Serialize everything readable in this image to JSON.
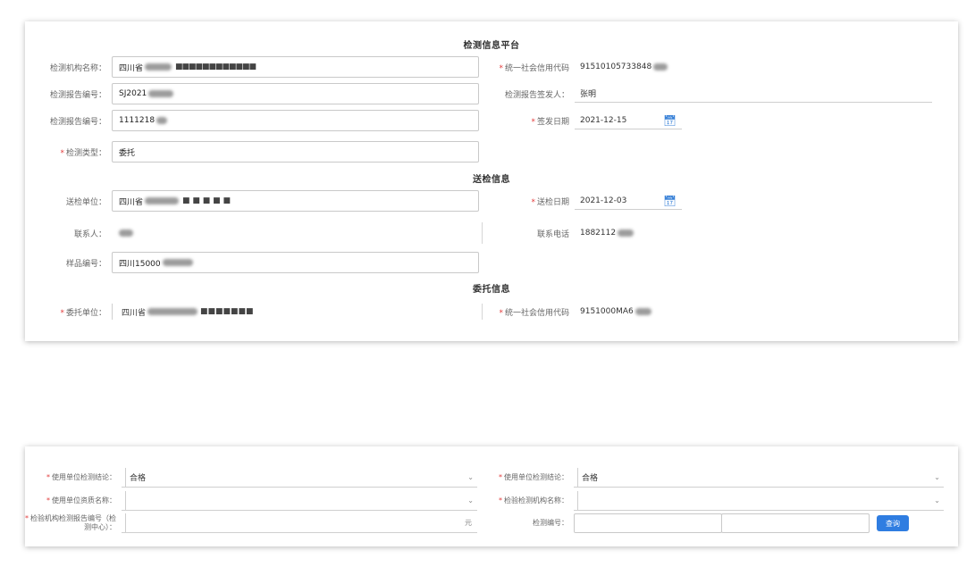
{
  "card1": {
    "sections": [
      "检测信息平台",
      "送检信息",
      "委托信息"
    ],
    "rows": [
      {
        "label": "检测机构名称",
        "value": "四川省",
        "required": false
      },
      {
        "label": "统一社会信用代码",
        "value": "91510105733848",
        "required": true
      },
      {
        "label": "检测报告编号",
        "value": "SJ2021",
        "required": false
      },
      {
        "label": "检测报告签发人",
        "value": "张明",
        "required": false
      },
      {
        "label": "检测报告编号",
        "value": "1111218",
        "required": false
      },
      {
        "label": "签发日期",
        "value": "2021-12-15",
        "required": true
      },
      {
        "label": "检测类型",
        "value": "委托",
        "required": true
      },
      {
        "label": "送检单位",
        "value": "四川省",
        "required": false
      },
      {
        "label": "送检日期",
        "value": "2021-12-03",
        "required": true
      },
      {
        "label": "联系人",
        "value": "",
        "required": false
      },
      {
        "label": "联系电话",
        "value": "1882112",
        "required": false
      },
      {
        "label": "样品编号",
        "value": "四川15000",
        "required": false
      },
      {
        "label": "委托单位",
        "value": "四川省",
        "required": true
      },
      {
        "label": "统一社会信用代码",
        "value": "9151000MA6",
        "required": true
      }
    ]
  },
  "card2": {
    "rows": [
      {
        "label": "使用单位检测结论",
        "value": "合格",
        "required": true
      },
      {
        "label": "使用单位检测结论",
        "value": "合格",
        "required": true
      },
      {
        "label": "使用单位资质名称",
        "value": "",
        "required": true
      },
      {
        "label": "检验检测机构名称",
        "value": "",
        "required": true
      },
      {
        "label": "检验机构检测报告编号（检测中心）",
        "value": "",
        "required": true
      },
      {
        "label": "检测编号",
        "value": "",
        "required": false
      }
    ],
    "unit": "元",
    "button": "查询"
  }
}
